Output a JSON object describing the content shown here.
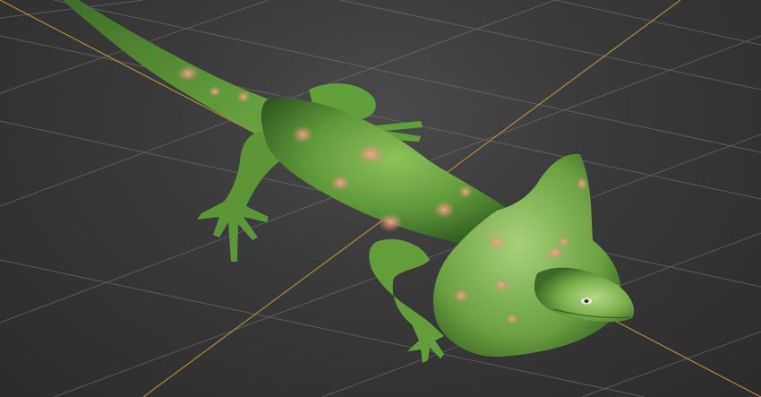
{
  "viewport": {
    "background_color": "#3a3a3a",
    "grid_color": "#8a8a8a",
    "axis_color": "#c7963f"
  },
  "model": {
    "subject": "frilled-lizard",
    "body_color": "#5f9a3a",
    "spot_color": "#e08a72"
  }
}
